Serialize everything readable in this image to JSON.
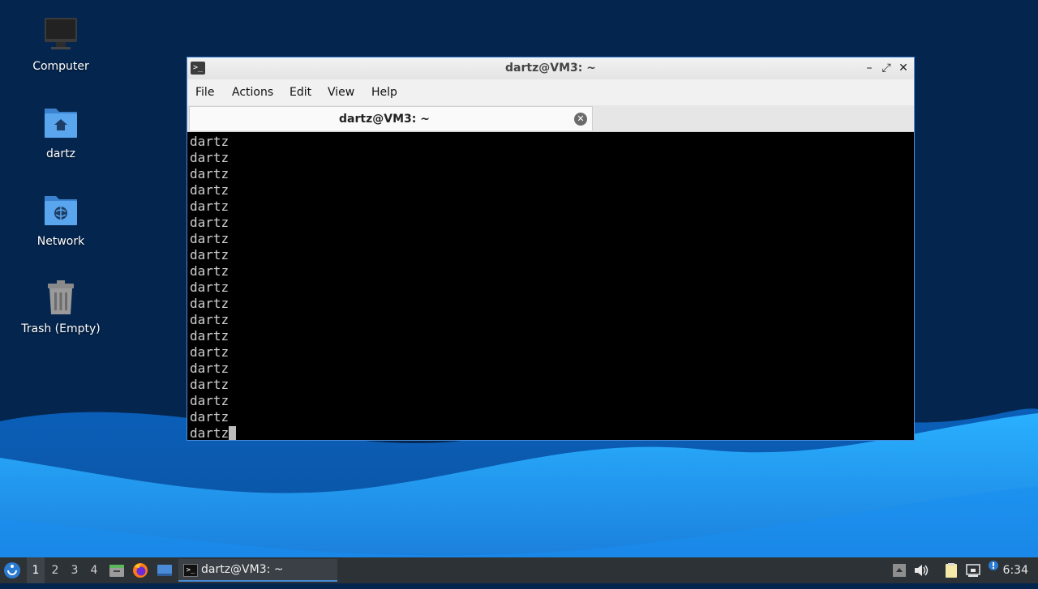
{
  "desktop": {
    "icons": [
      {
        "label": "Computer",
        "icon": "computer-icon"
      },
      {
        "label": "dartz",
        "icon": "home-folder-icon"
      },
      {
        "label": "Network",
        "icon": "network-folder-icon"
      },
      {
        "label": "Trash (Empty)",
        "icon": "trash-icon"
      }
    ]
  },
  "window": {
    "title": "dartz@VM3: ~",
    "controls": {
      "minimize": "–",
      "maximize": "⤢",
      "close": "✕"
    },
    "menu": [
      "File",
      "Actions",
      "Edit",
      "View",
      "Help"
    ],
    "tab": {
      "label": "dartz@VM3: ~",
      "close": "✕"
    },
    "terminal": {
      "lines": [
        "dartz",
        "dartz",
        "dartz",
        "dartz",
        "dartz",
        "dartz",
        "dartz",
        "dartz",
        "dartz",
        "dartz",
        "dartz",
        "dartz",
        "dartz",
        "dartz",
        "dartz",
        "dartz",
        "dartz",
        "dartz",
        "dartz"
      ]
    }
  },
  "taskbar": {
    "workspaces": [
      "1",
      "2",
      "3",
      "4"
    ],
    "active_workspace": "1",
    "launchers": [
      "file-manager-icon",
      "firefox-icon",
      "show-desktop-icon"
    ],
    "task": {
      "label": "dartz@VM3: ~"
    },
    "tray": [
      "tray-expand-icon",
      "volume-icon",
      "clipboard-icon",
      "network-icon",
      "update-notifier-icon"
    ],
    "clock": "6:34"
  },
  "colors": {
    "accent": "#4a8bd8",
    "wallpaper_dark": "#04254e",
    "wallpaper_light": "#1e9cf0"
  }
}
